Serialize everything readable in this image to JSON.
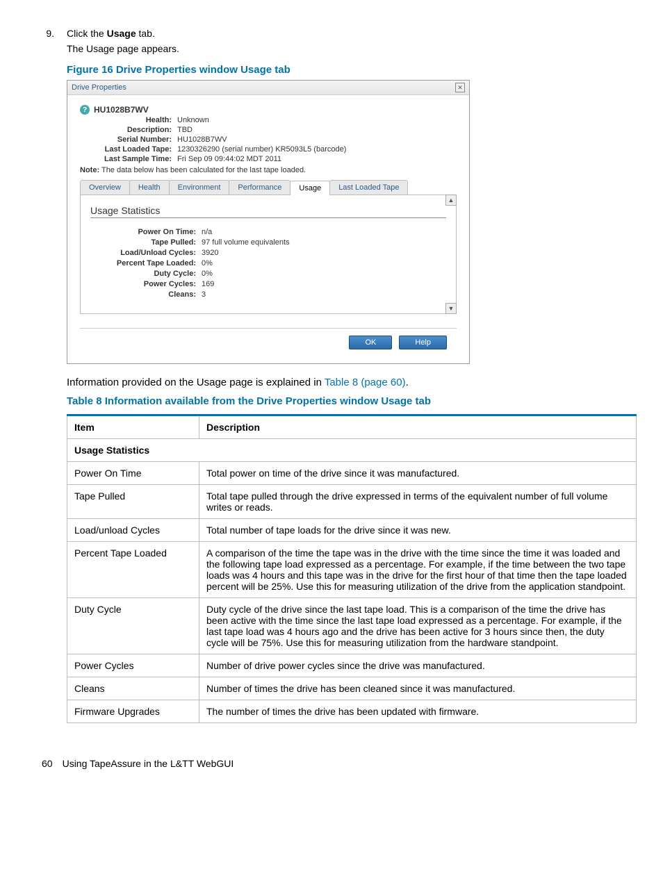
{
  "step": {
    "number": "9.",
    "line1_a": "Click the ",
    "line1_strong": "Usage",
    "line1_b": " tab.",
    "line2": "The Usage page appears."
  },
  "figure": {
    "title": "Figure 16 Drive Properties window Usage tab"
  },
  "shot": {
    "title": "Drive Properties",
    "close": "✕",
    "drive": "HU1028B7WV",
    "help_q": "?",
    "props": {
      "health_l": "Health:",
      "health_v": "Unknown",
      "desc_l": "Description:",
      "desc_v": "TBD",
      "serial_l": "Serial Number:",
      "serial_v": "HU1028B7WV",
      "last_tape_l": "Last Loaded Tape:",
      "last_tape_v": "1230326290 (serial number) KR5093L5 (barcode)",
      "last_time_l": "Last Sample Time:",
      "last_time_v": "Fri Sep 09 09:44:02 MDT 2011"
    },
    "note_l": "Note:",
    "note_v": "The data below has been calculated for the last tape loaded.",
    "tabs": {
      "overview": "Overview",
      "health": "Health",
      "environment": "Environment",
      "performance": "Performance",
      "usage": "Usage",
      "last_loaded": "Last Loaded Tape"
    },
    "stats_title": "Usage Statistics",
    "stats": {
      "pot_l": "Power On Time:",
      "pot_v": "n/a",
      "tp_l": "Tape Pulled:",
      "tp_v": "97 full volume equivalents",
      "lu_l": "Load/Unload Cycles:",
      "lu_v": "3920",
      "ptl_l": "Percent Tape Loaded:",
      "ptl_v": "0%",
      "dc_l": "Duty Cycle:",
      "dc_v": "0%",
      "pc_l": "Power Cycles:",
      "pc_v": "169",
      "cl_l": "Cleans:",
      "cl_v": "3"
    },
    "arrows": {
      "up": "▲",
      "down": "▼"
    },
    "ok": "OK",
    "help": "Help"
  },
  "body_p": {
    "pre": "Information provided on the Usage page is explained in ",
    "link": "Table 8 (page 60)",
    "post": "."
  },
  "table_title": "Table 8 Information available from the Drive Properties window Usage tab",
  "table": {
    "h1": "Item",
    "h2": "Description",
    "section": "Usage Statistics",
    "rows": [
      {
        "item": "Power On Time",
        "desc": "Total power on time of the drive since it was manufactured."
      },
      {
        "item": "Tape Pulled",
        "desc": "Total tape pulled through the drive expressed in terms of the equivalent number of full volume writes or reads."
      },
      {
        "item": "Load/unload Cycles",
        "desc": "Total number of tape loads for the drive since it was new."
      },
      {
        "item": "Percent Tape Loaded",
        "desc": "A comparison of the time the tape was in the drive with the time since the time it was loaded and the following tape load expressed as a percentage. For example, if the time between the two tape loads was 4 hours and this tape was in the drive for the first hour of that time then the tape loaded percent will be 25%. Use this for measuring utilization of the drive from the application standpoint."
      },
      {
        "item": "Duty Cycle",
        "desc": "Duty cycle of the drive since the last tape load. This is a comparison of the time the drive has been active with the time since the last tape load expressed as a percentage. For example, if the last tape load was 4 hours ago and the drive has been active for 3 hours since then, the duty cycle will be 75%. Use this for measuring utilization from the hardware standpoint."
      },
      {
        "item": "Power Cycles",
        "desc": "Number of drive power cycles since the drive was manufactured."
      },
      {
        "item": "Cleans",
        "desc": "Number of times the drive has been cleaned since it was manufactured."
      },
      {
        "item": "Firmware Upgrades",
        "desc": "The number of times the drive has been updated with firmware."
      }
    ]
  },
  "footer": {
    "page": "60",
    "title": "Using TapeAssure in the L&TT WebGUI"
  }
}
